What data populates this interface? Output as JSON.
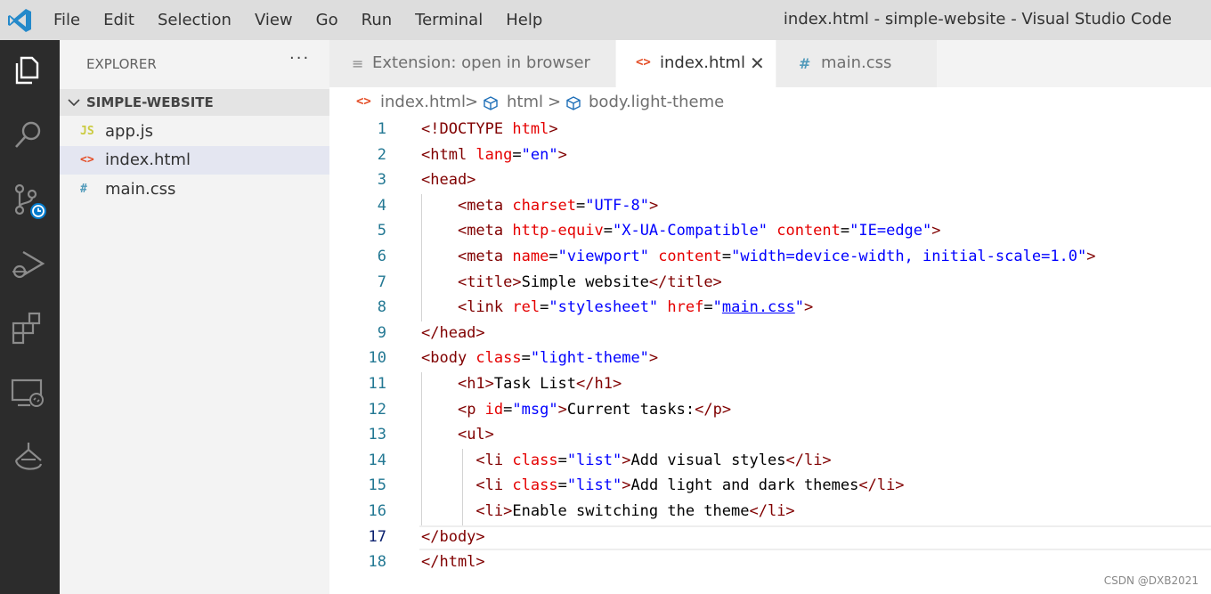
{
  "menu": [
    "File",
    "Edit",
    "Selection",
    "View",
    "Go",
    "Run",
    "Terminal",
    "Help"
  ],
  "window_title": "index.html - simple-website - Visual Studio Code",
  "sidebar": {
    "title": "EXPLORER",
    "more": "···",
    "folder": "SIMPLE-WEBSITE",
    "files": [
      {
        "icon": "JS",
        "label": "app.js",
        "icon_color": "#cbcb41"
      },
      {
        "icon": "<>",
        "label": "index.html",
        "icon_color": "#e44d26",
        "active": true
      },
      {
        "icon": "#",
        "label": "main.css",
        "icon_color": "#519aba"
      }
    ]
  },
  "tabs": [
    {
      "icon": "≡",
      "label": "Extension: open in browser"
    },
    {
      "icon": "<>",
      "label": "index.html",
      "active": true,
      "close": "✕"
    },
    {
      "icon": "#",
      "label": "main.css"
    }
  ],
  "breadcrumbs": {
    "file": "index.html",
    "sep": ">",
    "node1": "html",
    "node2": "body.light-theme"
  },
  "editor": {
    "current_line": 17,
    "lines": [
      {
        "n": "1",
        "tokens": [
          [
            "tag",
            "<!DOCTYPE "
          ],
          [
            "attr",
            "html"
          ],
          [
            "tag",
            ">"
          ]
        ]
      },
      {
        "n": "2",
        "tokens": [
          [
            "tag",
            "<html "
          ],
          [
            "attr",
            "lang"
          ],
          [
            "text",
            "="
          ],
          [
            "val",
            "\"en\""
          ],
          [
            "tag",
            ">"
          ]
        ]
      },
      {
        "n": "3",
        "tokens": [
          [
            "tag",
            "<head>"
          ]
        ]
      },
      {
        "n": "4",
        "tokens": [
          [
            "text",
            "    "
          ],
          [
            "tag",
            "<meta "
          ],
          [
            "attr",
            "charset"
          ],
          [
            "text",
            "="
          ],
          [
            "val",
            "\"UTF-8\""
          ],
          [
            "tag",
            ">"
          ]
        ]
      },
      {
        "n": "5",
        "tokens": [
          [
            "text",
            "    "
          ],
          [
            "tag",
            "<meta "
          ],
          [
            "attr",
            "http-equiv"
          ],
          [
            "text",
            "="
          ],
          [
            "val",
            "\"X-UA-Compatible\""
          ],
          [
            "text",
            " "
          ],
          [
            "attr",
            "content"
          ],
          [
            "text",
            "="
          ],
          [
            "val",
            "\"IE=edge\""
          ],
          [
            "tag",
            ">"
          ]
        ]
      },
      {
        "n": "6",
        "tokens": [
          [
            "text",
            "    "
          ],
          [
            "tag",
            "<meta "
          ],
          [
            "attr",
            "name"
          ],
          [
            "text",
            "="
          ],
          [
            "val",
            "\"viewport\""
          ],
          [
            "text",
            " "
          ],
          [
            "attr",
            "content"
          ],
          [
            "text",
            "="
          ],
          [
            "val",
            "\"width=device-width, initial-scale=1.0\""
          ],
          [
            "tag",
            ">"
          ]
        ]
      },
      {
        "n": "7",
        "tokens": [
          [
            "text",
            "    "
          ],
          [
            "tag",
            "<title>"
          ],
          [
            "text",
            "Simple website"
          ],
          [
            "tag",
            "</title>"
          ]
        ]
      },
      {
        "n": "8",
        "tokens": [
          [
            "text",
            "    "
          ],
          [
            "tag",
            "<link "
          ],
          [
            "attr",
            "rel"
          ],
          [
            "text",
            "="
          ],
          [
            "val",
            "\"stylesheet\""
          ],
          [
            "text",
            " "
          ],
          [
            "attr",
            "href"
          ],
          [
            "text",
            "="
          ],
          [
            "val",
            "\""
          ],
          [
            "link",
            "main.css"
          ],
          [
            "val",
            "\""
          ],
          [
            "tag",
            ">"
          ]
        ]
      },
      {
        "n": "9",
        "tokens": [
          [
            "tag",
            "</head>"
          ]
        ]
      },
      {
        "n": "10",
        "tokens": [
          [
            "tag",
            "<body "
          ],
          [
            "attr",
            "class"
          ],
          [
            "text",
            "="
          ],
          [
            "val",
            "\"light-theme\""
          ],
          [
            "tag",
            ">"
          ]
        ]
      },
      {
        "n": "11",
        "tokens": [
          [
            "text",
            "    "
          ],
          [
            "tag",
            "<h1>"
          ],
          [
            "text",
            "Task List"
          ],
          [
            "tag",
            "</h1>"
          ]
        ]
      },
      {
        "n": "12",
        "tokens": [
          [
            "text",
            "    "
          ],
          [
            "tag",
            "<p "
          ],
          [
            "attr",
            "id"
          ],
          [
            "text",
            "="
          ],
          [
            "val",
            "\"msg\""
          ],
          [
            "tag",
            ">"
          ],
          [
            "text",
            "Current tasks:"
          ],
          [
            "tag",
            "</p>"
          ]
        ]
      },
      {
        "n": "13",
        "tokens": [
          [
            "text",
            "    "
          ],
          [
            "tag",
            "<ul>"
          ]
        ]
      },
      {
        "n": "14",
        "tokens": [
          [
            "text",
            "      "
          ],
          [
            "tag",
            "<li "
          ],
          [
            "attr",
            "class"
          ],
          [
            "text",
            "="
          ],
          [
            "val",
            "\"list\""
          ],
          [
            "tag",
            ">"
          ],
          [
            "text",
            "Add visual styles"
          ],
          [
            "tag",
            "</li>"
          ]
        ]
      },
      {
        "n": "15",
        "tokens": [
          [
            "text",
            "      "
          ],
          [
            "tag",
            "<li "
          ],
          [
            "attr",
            "class"
          ],
          [
            "text",
            "="
          ],
          [
            "val",
            "\"list\""
          ],
          [
            "tag",
            ">"
          ],
          [
            "text",
            "Add light and dark themes"
          ],
          [
            "tag",
            "</li>"
          ]
        ]
      },
      {
        "n": "16",
        "tokens": [
          [
            "text",
            "      "
          ],
          [
            "tag",
            "<li>"
          ],
          [
            "text",
            "Enable switching the theme"
          ],
          [
            "tag",
            "</li>"
          ]
        ]
      },
      {
        "n": "17",
        "tokens": [
          [
            "tag",
            "</body>"
          ]
        ]
      },
      {
        "n": "18",
        "tokens": [
          [
            "tag",
            "</html>"
          ]
        ]
      }
    ]
  },
  "watermark": "CSDN @DXB2021"
}
